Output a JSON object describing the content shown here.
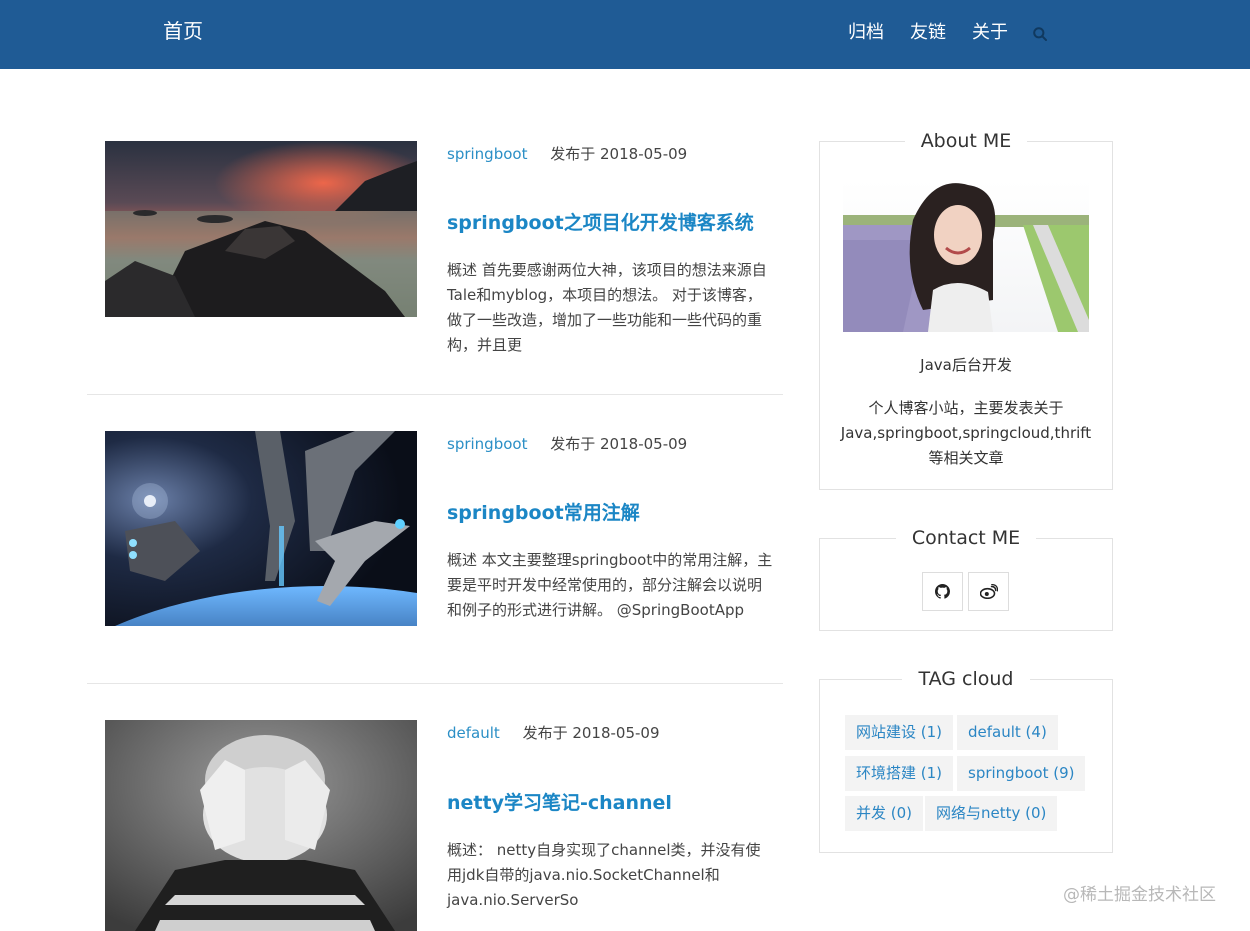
{
  "header": {
    "brand": "首页",
    "nav": [
      "归档",
      "友链",
      "关于"
    ],
    "search_icon": "search-icon",
    "bg_color": "#1f5b95"
  },
  "posts": [
    {
      "category": "springboot",
      "date": "发布于 2018-05-09",
      "title": "springboot之项目化开发博客系统",
      "excerpt": "概述 首先要感谢两位大神，该项目的想法来源自Tale和myblog，本项目的想法。 对于该博客，做了一些改造，增加了一些功能和一些代码的重构，并且更"
    },
    {
      "category": "springboot",
      "date": "发布于 2018-05-09",
      "title": "springboot常用注解",
      "excerpt": "概述 本文主要整理springboot中的常用注解，主要是平时开发中经常使用的，部分注解会以说明和例子的形式进行讲解。 @SpringBootApp"
    },
    {
      "category": "default",
      "date": "发布于 2018-05-09",
      "title": "netty学习笔记-channel",
      "excerpt": "概述： netty自身实现了channel类，并没有使用jdk自带的java.nio.SocketChannel和java.nio.ServerSo"
    }
  ],
  "sidebar": {
    "about": {
      "title": "About ME",
      "role": "Java后台开发",
      "bio": "个人博客小站，主要发表关于Java,springboot,springcloud,thrift等相关文章"
    },
    "contact": {
      "title": "Contact ME",
      "icons": [
        "github-icon",
        "weibo-icon"
      ]
    },
    "tags": {
      "title": "TAG cloud",
      "items": [
        "网站建设 (1)",
        "default (4)",
        "环境搭建 (1)",
        "springboot (9)",
        "并发 (0)",
        "网络与netty (0)"
      ]
    }
  },
  "watermark": "@稀土掘金技术社区",
  "colors": {
    "link": "#1b86c5",
    "text": "#333333",
    "tag_bg": "#f3f3f3"
  }
}
